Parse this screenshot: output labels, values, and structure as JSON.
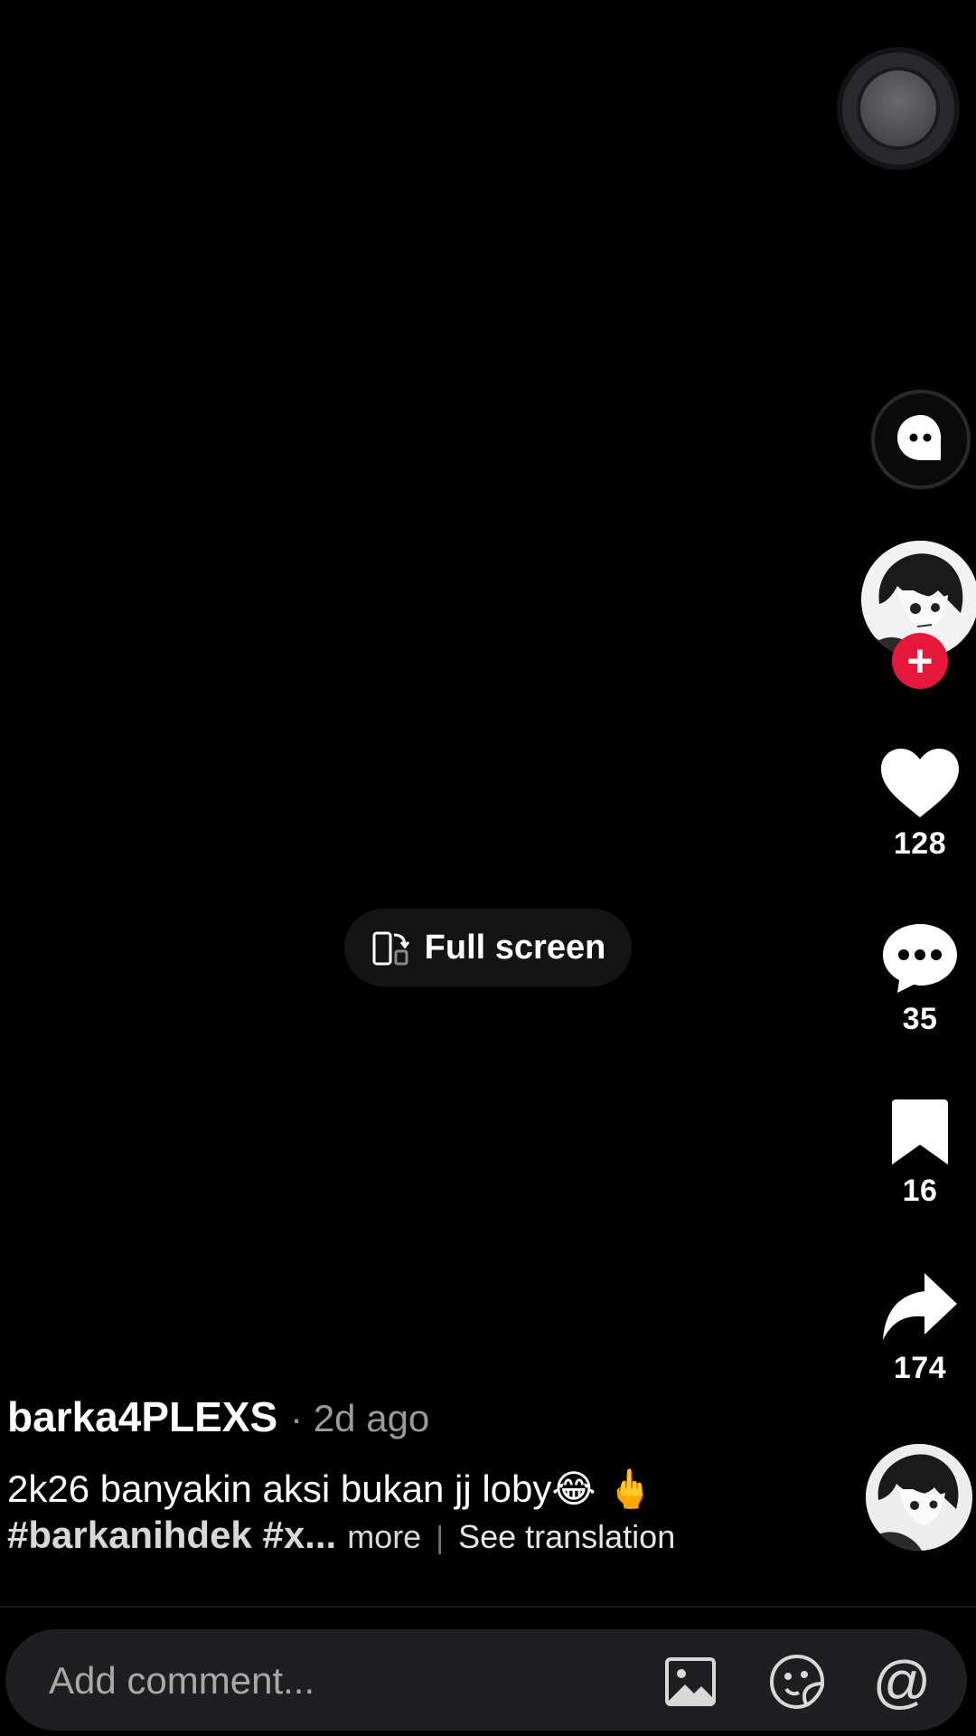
{
  "video": {
    "fullscreen_label": "Full screen"
  },
  "actions": {
    "likes": "128",
    "comments": "35",
    "bookmarks": "16",
    "shares": "174"
  },
  "post": {
    "author": "barka4PLEXS",
    "time": "· 2d ago",
    "caption": "2k26 banyakin aksi bukan jj loby😂 🖕",
    "hashtags": "#barkanihdek #x...",
    "more_label": "more",
    "separator": "|",
    "translate_label": "See translation"
  },
  "comment_bar": {
    "placeholder": "Add comment...",
    "mention_symbol": "@"
  },
  "icons": {
    "ai": "ai-chat-icon",
    "follow": "plus-icon",
    "like": "heart-icon",
    "comment": "comment-bubble-icon",
    "bookmark": "bookmark-icon",
    "share": "share-arrow-icon",
    "fullscreen": "fullscreen-rotate-icon",
    "image": "image-icon",
    "sticker": "sticker-icon",
    "mention": "at-icon"
  },
  "colors": {
    "background": "#000000",
    "follow_red": "#e5173b",
    "bar": "#1f1f21",
    "muted_text": "#9a9a9a"
  }
}
